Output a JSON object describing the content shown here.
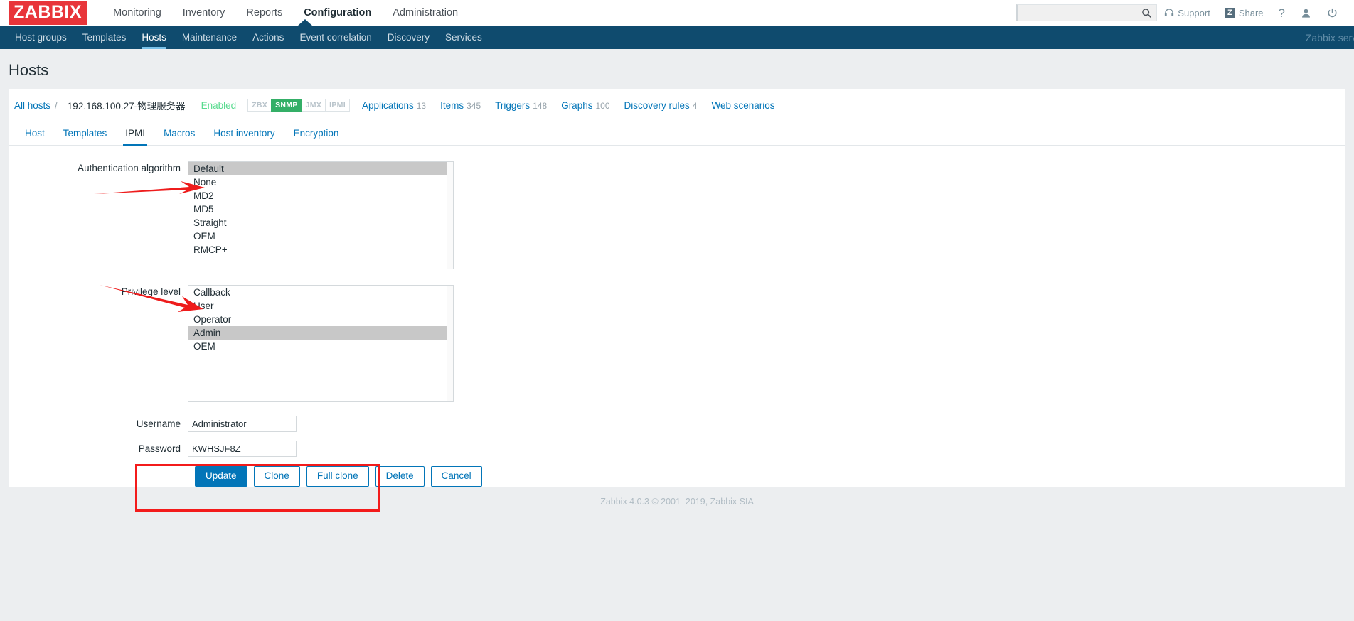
{
  "brand": {
    "logo_text": "ZABBIX"
  },
  "main_menu": [
    {
      "label": "Monitoring",
      "active": false
    },
    {
      "label": "Inventory",
      "active": false
    },
    {
      "label": "Reports",
      "active": false
    },
    {
      "label": "Configuration",
      "active": true
    },
    {
      "label": "Administration",
      "active": false
    }
  ],
  "top_right": {
    "search_value": "",
    "search_placeholder": "",
    "support_label": "Support",
    "share_label": "Share",
    "share_badge": "Z",
    "help_label": "?",
    "user_icon": "user-icon",
    "signout_icon": "power-icon"
  },
  "sub_menu": [
    {
      "label": "Host groups",
      "active": false
    },
    {
      "label": "Templates",
      "active": false
    },
    {
      "label": "Hosts",
      "active": true
    },
    {
      "label": "Maintenance",
      "active": false
    },
    {
      "label": "Actions",
      "active": false
    },
    {
      "label": "Event correlation",
      "active": false
    },
    {
      "label": "Discovery",
      "active": false
    },
    {
      "label": "Services",
      "active": false
    }
  ],
  "server_label": "Zabbix serve",
  "page_title": "Hosts",
  "breadcrumb": {
    "all_hosts": "All hosts",
    "separator": "/",
    "host_name": "192.168.100.27-物理服务器",
    "status": "Enabled",
    "interfaces": [
      {
        "label": "ZBX",
        "enabled": false
      },
      {
        "label": "SNMP",
        "enabled": true
      },
      {
        "label": "JMX",
        "enabled": false
      },
      {
        "label": "IPMI",
        "enabled": false
      }
    ],
    "links": [
      {
        "label": "Applications",
        "count": "13"
      },
      {
        "label": "Items",
        "count": "345"
      },
      {
        "label": "Triggers",
        "count": "148"
      },
      {
        "label": "Graphs",
        "count": "100"
      },
      {
        "label": "Discovery rules",
        "count": "4"
      },
      {
        "label": "Web scenarios",
        "count": ""
      }
    ]
  },
  "tabs": [
    {
      "label": "Host",
      "active": false
    },
    {
      "label": "Templates",
      "active": false
    },
    {
      "label": "IPMI",
      "active": true
    },
    {
      "label": "Macros",
      "active": false
    },
    {
      "label": "Host inventory",
      "active": false
    },
    {
      "label": "Encryption",
      "active": false
    }
  ],
  "form": {
    "auth_algorithm": {
      "label": "Authentication algorithm",
      "options": [
        "Default",
        "None",
        "MD2",
        "MD5",
        "Straight",
        "OEM",
        "RMCP+"
      ],
      "selected": "Default"
    },
    "privilege_level": {
      "label": "Privilege level",
      "options": [
        "Callback",
        "User",
        "Operator",
        "Admin",
        "OEM"
      ],
      "selected": "Admin"
    },
    "username": {
      "label": "Username",
      "value": "Administrator",
      "placeholder": ""
    },
    "password": {
      "label": "Password",
      "value": "KWHSJF8Z",
      "placeholder": ""
    }
  },
  "buttons": [
    {
      "label": "Update",
      "kind": "primary"
    },
    {
      "label": "Clone",
      "kind": "secondary"
    },
    {
      "label": "Full clone",
      "kind": "secondary"
    },
    {
      "label": "Delete",
      "kind": "secondary"
    },
    {
      "label": "Cancel",
      "kind": "secondary"
    }
  ],
  "annotations": {
    "highlight_color": "#f31b1b",
    "arrow_color": "#ee1c1c",
    "arrow_count": 2
  },
  "footer": "Zabbix 4.0.3 © 2001–2019, Zabbix SIA"
}
